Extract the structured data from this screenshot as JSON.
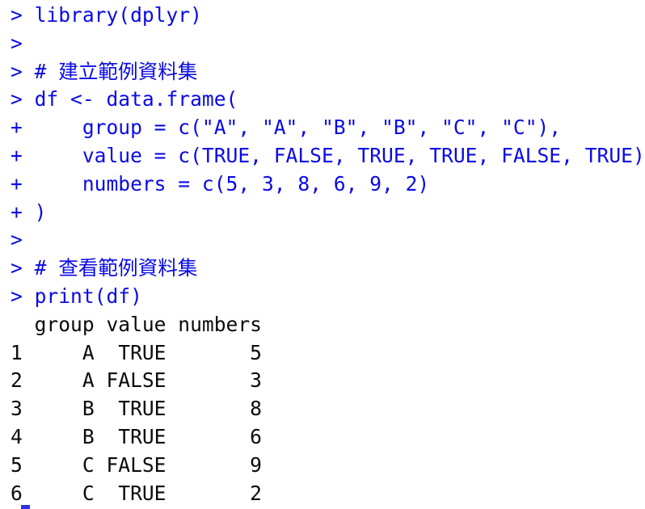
{
  "terminal": {
    "app": "R Console",
    "prompt_symbol": ">",
    "continuation_symbol": "+",
    "background_color": "#ffffff",
    "input_color": "#0A0AE6",
    "output_color": "#0a0a0a",
    "font_size_px": 24.6,
    "line_height_px": 34.8
  },
  "lines": [
    {
      "kind": "input",
      "text": "> library(dplyr)"
    },
    {
      "kind": "input",
      "text": ">"
    },
    {
      "kind": "input",
      "text": "> # 建立範例資料集"
    },
    {
      "kind": "input",
      "text": "> df <- data.frame("
    },
    {
      "kind": "input",
      "text": "+     group = c(\"A\", \"A\", \"B\", \"B\", \"C\", \"C\"),"
    },
    {
      "kind": "input",
      "text": "+     value = c(TRUE, FALSE, TRUE, TRUE, FALSE, TRUE),"
    },
    {
      "kind": "input",
      "text": "+     numbers = c(5, 3, 8, 6, 9, 2)"
    },
    {
      "kind": "input",
      "text": "+ )"
    },
    {
      "kind": "input",
      "text": ">"
    },
    {
      "kind": "input",
      "text": "> # 查看範例資料集"
    },
    {
      "kind": "input",
      "text": "> print(df)"
    },
    {
      "kind": "output",
      "text": "  group value numbers"
    },
    {
      "kind": "output",
      "text": "1     A  TRUE       5"
    },
    {
      "kind": "output",
      "text": "2     A FALSE       3"
    },
    {
      "kind": "output",
      "text": "3     B  TRUE       8"
    },
    {
      "kind": "output",
      "text": "4     B  TRUE       6"
    },
    {
      "kind": "output",
      "text": "5     C FALSE       9"
    },
    {
      "kind": "output",
      "text": "6     C  TRUE       2"
    }
  ],
  "commands": {
    "library_call": "library(dplyr)",
    "comment_create": "# 建立範例資料集",
    "comment_view": "# 查看範例資料集",
    "dataframe_open": "df <- data.frame(",
    "arg_group": "group = c(\"A\", \"A\", \"B\", \"B\", \"C\", \"C\"),",
    "arg_value": "value = c(TRUE, FALSE, TRUE, TRUE, FALSE, TRUE),",
    "arg_numbers": "numbers = c(5, 3, 8, 6, 9, 2)",
    "dataframe_close": ")",
    "print_call": "print(df)"
  },
  "data_frame": {
    "name": "df",
    "columns": [
      "group",
      "value",
      "numbers"
    ],
    "row_names": [
      "1",
      "2",
      "3",
      "4",
      "5",
      "6"
    ],
    "rows": [
      {
        "index": "1",
        "group": "A",
        "value": "TRUE",
        "numbers": "5"
      },
      {
        "index": "2",
        "group": "A",
        "value": "FALSE",
        "numbers": "3"
      },
      {
        "index": "3",
        "group": "B",
        "value": "TRUE",
        "numbers": "8"
      },
      {
        "index": "4",
        "group": "B",
        "value": "TRUE",
        "numbers": "6"
      },
      {
        "index": "5",
        "group": "C",
        "value": "FALSE",
        "numbers": "9"
      },
      {
        "index": "6",
        "group": "C",
        "value": "TRUE",
        "numbers": "2"
      }
    ]
  }
}
